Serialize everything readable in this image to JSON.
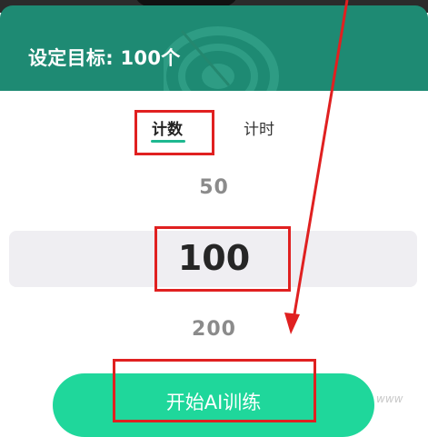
{
  "header": {
    "title": "设定目标: 100个"
  },
  "tabs": [
    {
      "label": "计数",
      "active": true
    },
    {
      "label": "计时",
      "active": false
    }
  ],
  "picker": {
    "previous": "50",
    "current": "100",
    "next": "200"
  },
  "start_button": {
    "label": "开始AI训练"
  },
  "watermark": {
    "text": "www"
  },
  "colors": {
    "header_bg": "#1e8a73",
    "accent": "#1eb890",
    "button_bg": "#1fd79b",
    "annotation": "#e02020"
  }
}
